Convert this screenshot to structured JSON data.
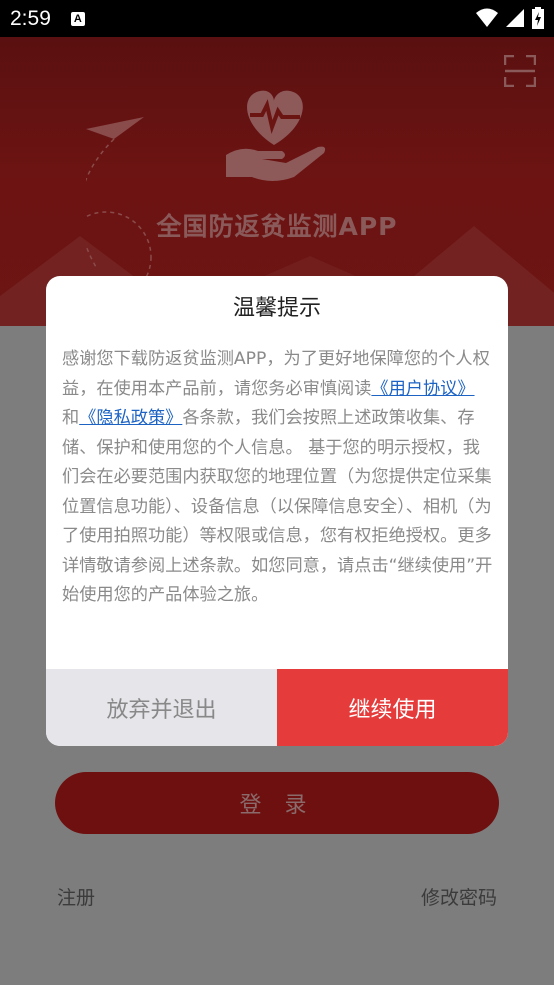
{
  "status_bar": {
    "time": "2:59",
    "notification_glyph": "A"
  },
  "header": {
    "app_title": "全国防返贫监测APP"
  },
  "login": {
    "login_label": "登 录",
    "register_label": "注册",
    "change_password_label": "修改密码"
  },
  "dialog": {
    "title": "温馨提示",
    "text_1": "感谢您下载防返贫监测APP，为了更好地保障您的个人权益，在使用本产品前，请您务必审慎阅读",
    "user_agreement_link": "《用户协议》",
    "text_2": " 和",
    "privacy_link": "《隐私政策》",
    "text_3": "各条款，我们会按照上述政策收集、存储、保护和使用您的个人信息。 基于您的明示授权，我们会在必要范围内获取您的地理位置（为您提供定位采集位置信息功能）、设备信息（以保障信息安全）、相机（为了使用拍照功能）等权限或信息，您有权拒绝授权。更多详情敬请参阅上述条款。如您同意，请点击“继续使用”开始使用您的产品体验之旅。",
    "quit_label": "放弃并退出",
    "continue_label": "继续使用"
  },
  "colors": {
    "accent_red": "#e63b3b",
    "link_blue": "#1d63c4",
    "hero_red": "#6d1413"
  }
}
